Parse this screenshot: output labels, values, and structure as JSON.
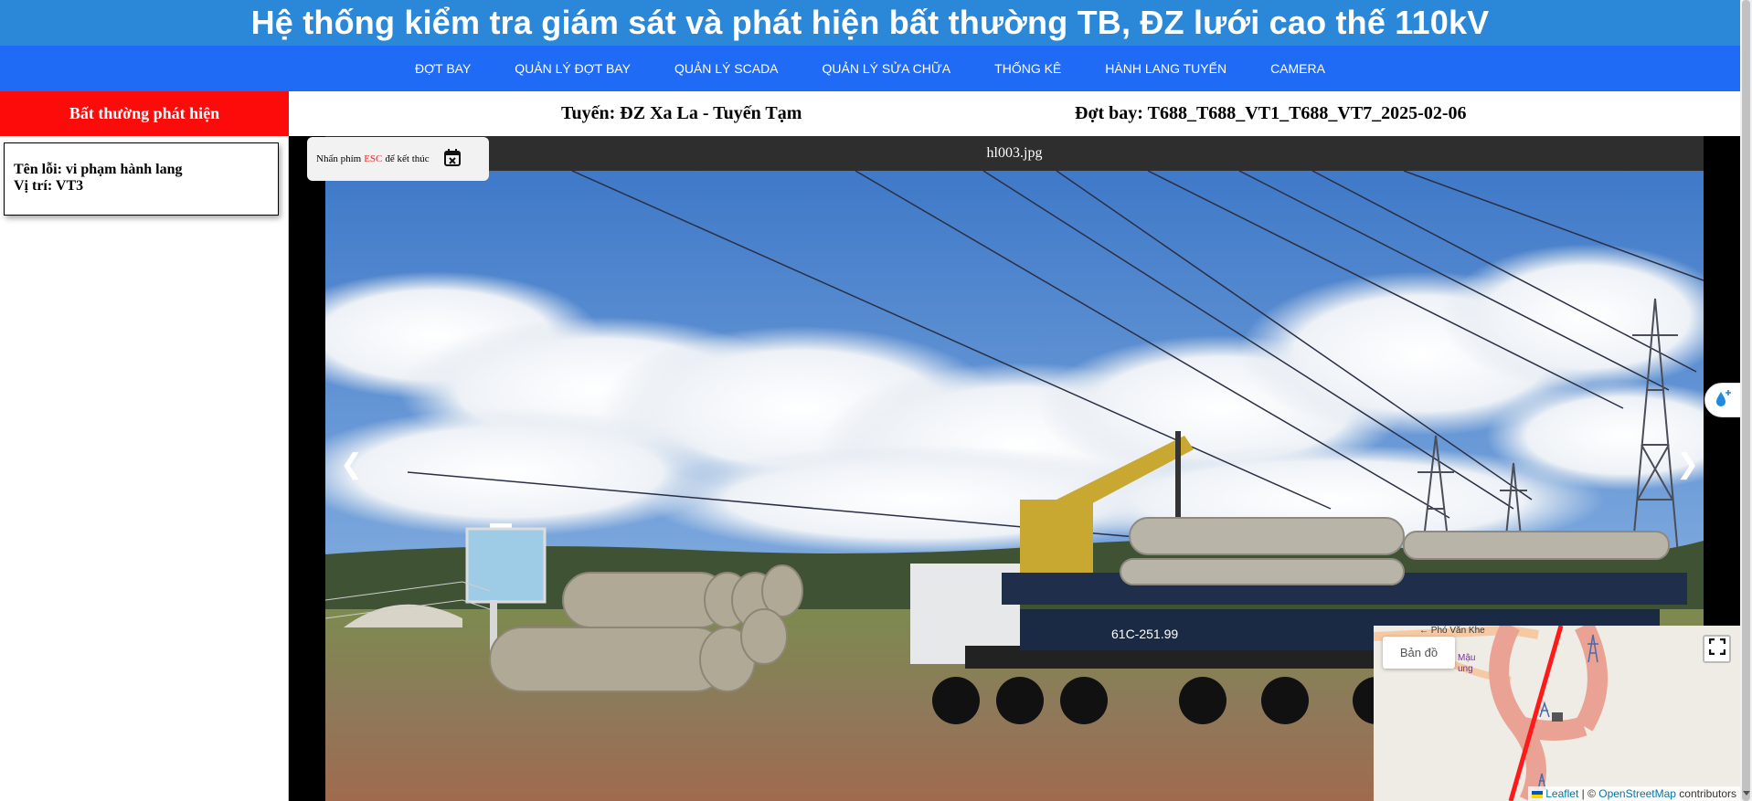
{
  "header": {
    "title": "Hệ thống kiểm tra giám sát và phát hiện bất thường TB, ĐZ lưới cao thế 110kV"
  },
  "nav": {
    "items": [
      {
        "label": "ĐỢT BAY"
      },
      {
        "label": "QUẢN LÝ ĐỢT BAY"
      },
      {
        "label": "QUẢN LÝ SCADA"
      },
      {
        "label": "QUẢN LÝ SỬA CHỮA"
      },
      {
        "label": "THỐNG KÊ"
      },
      {
        "label": "HÀNH LANG TUYẾN"
      },
      {
        "label": "CAMERA"
      }
    ]
  },
  "sidebar": {
    "header": "Bất thường phát hiện",
    "cards": [
      {
        "error_label": "Tên lỗi: vi phạm hành lang",
        "position_label": "Vị trí: VT3"
      }
    ]
  },
  "info": {
    "route": "Tuyến: ĐZ Xa La - Tuyến Tạm",
    "flight": "Đợt bay: T688_T688_VT1_T688_VT7_2025-02-06"
  },
  "viewer": {
    "filename": "hl003.jpg",
    "esc_prefix": "Nhấn phím",
    "esc_key": "ESC",
    "esc_suffix": "để kết thúc",
    "prev_arrow": "❮",
    "next_arrow": "❯",
    "truck_plate": "61C-251.99"
  },
  "map": {
    "layer_button": "Bản đồ",
    "street_label_1": "← Phó Văn Khe",
    "street_label_2": "Mậu",
    "street_label_3": "ung",
    "attribution_leaflet": "Leaflet",
    "attribution_sep": " | © ",
    "attribution_osm": "OpenStreetMap",
    "attribution_suffix": " contributors"
  },
  "colors": {
    "title_bar": "#2b88d8",
    "nav_bar": "#1f6bf5",
    "sidebar_header": "#fd0a0a",
    "esc_key": "#ff2020"
  },
  "icons": [
    "calendar-close-icon",
    "water-drop-icon",
    "fullscreen-icon",
    "chevron-left-icon",
    "chevron-right-icon",
    "ukraine-flag-icon"
  ]
}
